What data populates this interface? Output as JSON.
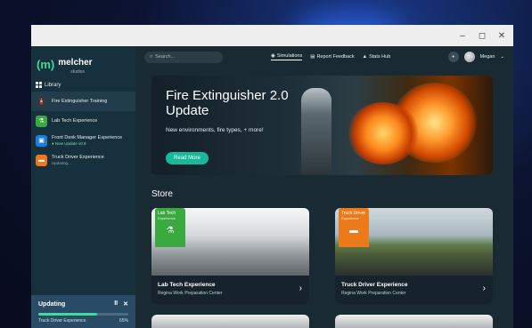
{
  "window": {
    "controls": {
      "minimize": "–",
      "maximize": "◻",
      "close": "✕"
    }
  },
  "sidebar": {
    "brand": "melcher",
    "brand_sub": "studios",
    "library_label": "Library",
    "items": [
      {
        "label": "Fire Extinguisher Training",
        "sub": "",
        "icon": "fire-extinguisher-icon",
        "color": "#2c3a44"
      },
      {
        "label": "Lab Tech Experience",
        "sub": "",
        "icon": "lab-flask-icon",
        "color": "#3aa93f"
      },
      {
        "label": "Front Desk Manager Experience",
        "sub": "● New Update v0.9",
        "icon": "front-desk-icon",
        "color": "#1f7fd8"
      },
      {
        "label": "Truck Driver Experience",
        "sub": "Updating...",
        "icon": "truck-icon",
        "color": "#ec7a1a"
      }
    ],
    "updating": {
      "title": "Updating",
      "pause": "II",
      "close": "✕",
      "item": "Truck Driver Experience",
      "percent": "65%",
      "progress": 0.65
    }
  },
  "topbar": {
    "search_placeholder": "Search...",
    "nav": [
      {
        "label": "Simulations",
        "active": true
      },
      {
        "label": "Report Feedback",
        "active": false
      },
      {
        "label": "Stats Hub",
        "active": false
      }
    ],
    "user_name": "Megan"
  },
  "hero": {
    "title": "Fire Extinguisher 2.0 Update",
    "subtitle": "New environments, fire types, + more!",
    "button": "Read More"
  },
  "store": {
    "title": "Store",
    "cards": [
      {
        "badge": "Lab Tech",
        "badge_sub": "Experience",
        "name": "Lab Tech Experience",
        "org": "Regina Work Preparation Center",
        "color": "#3aa93f"
      },
      {
        "badge": "Truck Driver",
        "badge_sub": "Experience",
        "name": "Truck Driver Experience",
        "org": "Regina Work Preparation Center",
        "color": "#ec7a1a"
      }
    ]
  }
}
